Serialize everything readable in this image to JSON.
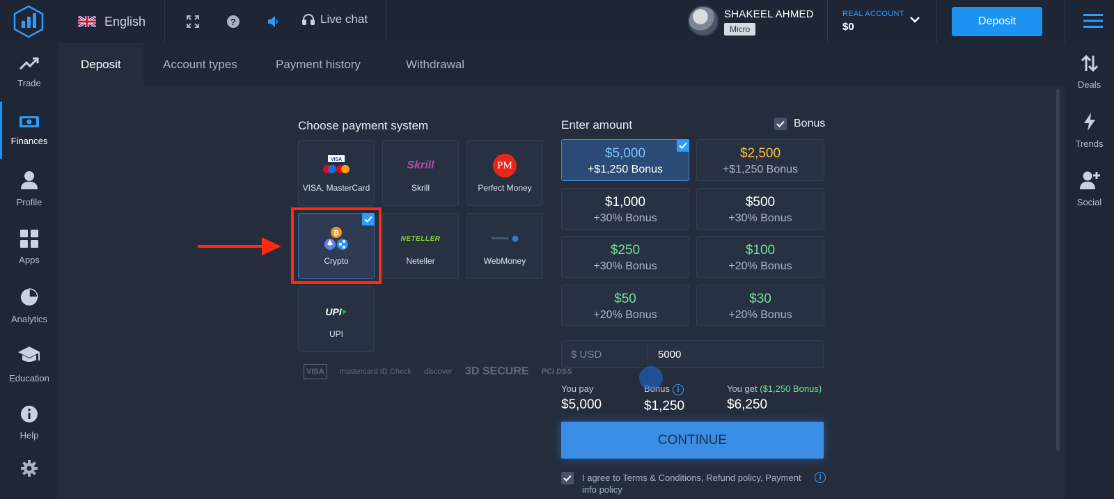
{
  "topbar": {
    "language": "English",
    "live_chat": "Live chat",
    "user_name": "SHAKEEL AHMED",
    "user_badge": "Micro",
    "account_label": "REAL ACCOUNT",
    "account_balance": "$0",
    "deposit_label": "Deposit"
  },
  "left_nav": [
    {
      "label": "Trade",
      "icon": "trend-up-icon"
    },
    {
      "label": "Finances",
      "icon": "money-icon",
      "active": true
    },
    {
      "label": "Profile",
      "icon": "user-icon"
    },
    {
      "label": "Apps",
      "icon": "grid-icon"
    },
    {
      "label": "Analytics",
      "icon": "pie-chart-icon"
    },
    {
      "label": "Education",
      "icon": "graduation-cap-icon"
    },
    {
      "label": "Help",
      "icon": "info-icon"
    }
  ],
  "right_nav": [
    {
      "label": "Deals",
      "icon": "swap-vertical-icon"
    },
    {
      "label": "Trends",
      "icon": "lightning-icon"
    },
    {
      "label": "Social",
      "icon": "add-user-icon"
    }
  ],
  "tabs": [
    "Deposit",
    "Account types",
    "Payment history",
    "Withdrawal"
  ],
  "payment": {
    "title": "Choose payment system",
    "methods": [
      {
        "label": "VISA, MasterCard"
      },
      {
        "label": "Skrill"
      },
      {
        "label": "Perfect Money"
      },
      {
        "label": "Crypto",
        "selected": true
      },
      {
        "label": "Neteller"
      },
      {
        "label": "WebMoney"
      },
      {
        "label": "UPI"
      }
    ],
    "logos": {
      "skrill": "Skrill",
      "pm": "PM",
      "neteller": "NETELLER",
      "upi": "UPI",
      "visa": "VISA",
      "webmoney": "WebMoney"
    },
    "trust_badges": [
      "VISA",
      "mastercard ID Check",
      "discover",
      "3D SECURE",
      "PCI DSS"
    ]
  },
  "amount": {
    "title": "Enter amount",
    "bonus_label": "Bonus",
    "options": [
      {
        "value": "$5,000",
        "bonus": "+$1,250 Bonus",
        "selected": true
      },
      {
        "value": "$2,500",
        "bonus": "+$1,250 Bonus"
      },
      {
        "value": "$1,000",
        "bonus": "+30% Bonus"
      },
      {
        "value": "$500",
        "bonus": "+30% Bonus"
      },
      {
        "value": "$250",
        "bonus": "+30% Bonus"
      },
      {
        "value": "$100",
        "bonus": "+20% Bonus"
      },
      {
        "value": "$50",
        "bonus": "+20% Bonus"
      },
      {
        "value": "$30",
        "bonus": "+20% Bonus"
      }
    ],
    "currency_label": "$ USD",
    "input_value": "5000"
  },
  "summary": {
    "you_pay_label": "You pay",
    "you_pay_value": "$5,000",
    "bonus_label": "Bonus",
    "bonus_value": "$1,250",
    "you_get_label": "You get",
    "you_get_bonus": "($1,250 Bonus)",
    "you_get_value": "$6,250"
  },
  "continue_label": "CONTINUE",
  "agree_text": "I agree to Terms & Conditions, Refund policy, Payment info policy",
  "colors": {
    "accent": "#1c93f0",
    "highlight": "#ff2a10",
    "green": "#6fe09a",
    "orange": "#ffc044"
  }
}
